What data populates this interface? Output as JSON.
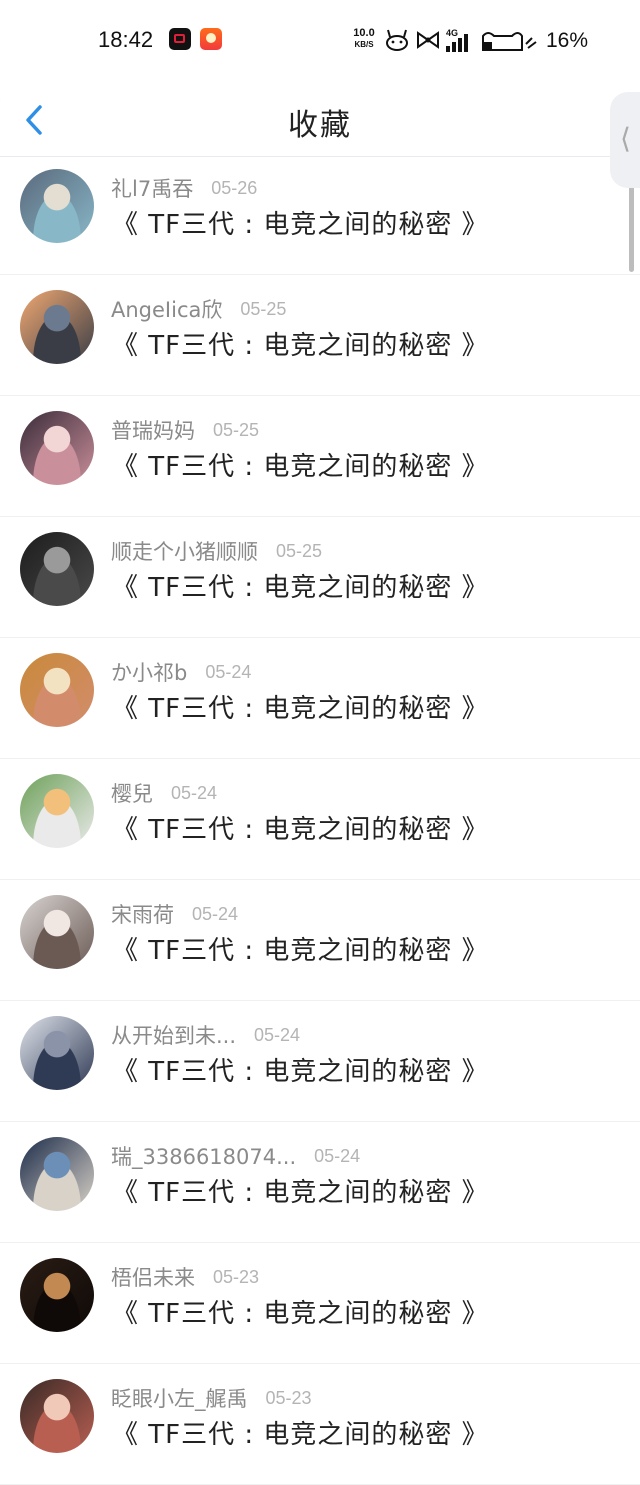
{
  "status_bar": {
    "time": "18:42",
    "net_speed": "10.0",
    "net_unit": "KB/S",
    "network": "4G",
    "battery": "16%"
  },
  "header": {
    "title": "收藏"
  },
  "items": [
    {
      "user": "礼l7禹吞",
      "date": "05-26",
      "title": "《 TF三代 : 电竞之间的秘密 》",
      "avatar_colors": [
        "#5a6a7c",
        "#e3ddd2",
        "#88b7c8"
      ]
    },
    {
      "user": "AngeIica欣",
      "date": "05-25",
      "title": "《 TF三代 : 电竞之间的秘密 》",
      "avatar_colors": [
        "#f0a872",
        "#6c7a90",
        "#3a3d46"
      ]
    },
    {
      "user": "普瑞妈妈",
      "date": "05-25",
      "title": "《 TF三代 : 电竞之间的秘密 》",
      "avatar_colors": [
        "#3b2c3a",
        "#f2d6d6",
        "#c98f9a"
      ]
    },
    {
      "user": "顺走个小猪顺顺",
      "date": "05-25",
      "title": "《 TF三代 : 电竞之间的秘密 》",
      "avatar_colors": [
        "#1c1c1c",
        "#9a9a9a",
        "#4a4a4a"
      ]
    },
    {
      "user": "か小祁b",
      "date": "05-24",
      "title": "《 TF三代 : 电竞之间的秘密 》",
      "avatar_colors": [
        "#c98a3a",
        "#f3e2c2",
        "#d28c6c"
      ]
    },
    {
      "user": "樱兒",
      "date": "05-24",
      "title": "《 TF三代 : 电竞之间的秘密 》",
      "avatar_colors": [
        "#6ea15a",
        "#f2c07a",
        "#eaeaea"
      ]
    },
    {
      "user": "宋雨荷",
      "date": "05-24",
      "title": "《 TF三代 : 电竞之间的秘密 》",
      "avatar_colors": [
        "#d8d4d2",
        "#f1e7e2",
        "#6b5a54"
      ]
    },
    {
      "user": "从开始到未...",
      "date": "05-24",
      "title": "《 TF三代 : 电竞之间的秘密 》",
      "avatar_colors": [
        "#dfe3ea",
        "#8b93a8",
        "#2f3a55"
      ]
    },
    {
      "user": "瑞_3386618074...",
      "date": "05-24",
      "title": "《 TF三代 : 电竞之间的秘密 》",
      "avatar_colors": [
        "#1c2c4a",
        "#6c8fb8",
        "#d9d2c8"
      ]
    },
    {
      "user": "梧侣未来",
      "date": "05-23",
      "title": "《 TF三代 : 电竞之间的秘密 》",
      "avatar_colors": [
        "#2a1c14",
        "#c28a52",
        "#0f0a08"
      ]
    },
    {
      "user": "眨眼小左_艉禹",
      "date": "05-23",
      "title": "《 TF三代 : 电竞之间的秘密 》",
      "avatar_colors": [
        "#3a2a26",
        "#f0c9b8",
        "#b85f52"
      ]
    }
  ],
  "colors": {
    "accent": "#2f8fe6",
    "username": "#8a8a8a",
    "date": "#b4b4b4",
    "title": "#222222"
  }
}
